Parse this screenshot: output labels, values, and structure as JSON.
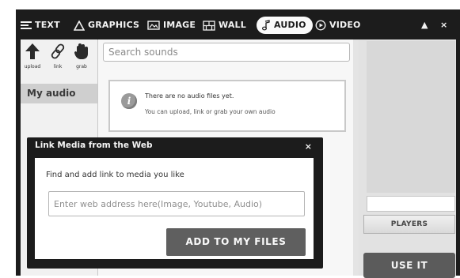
{
  "tabs": [
    {
      "label": "TEXT",
      "icon": "menu-lines-icon"
    },
    {
      "label": "GRAPHICS",
      "icon": "triangle-icon"
    },
    {
      "label": "IMAGE",
      "icon": "image-icon"
    },
    {
      "label": "WALL",
      "icon": "wall-icon"
    },
    {
      "label": "AUDIO",
      "icon": "music-note-icon",
      "active": true
    },
    {
      "label": "VIDEO",
      "icon": "play-circle-icon"
    }
  ],
  "window_controls": {
    "collapse": "▲",
    "close": "×"
  },
  "tools": [
    {
      "label": "upload",
      "icon": "upload-arrow-icon"
    },
    {
      "label": "link",
      "icon": "chain-link-icon"
    },
    {
      "label": "grab",
      "icon": "grab-hand-icon"
    }
  ],
  "sidebar": {
    "my_audio": "My audio"
  },
  "search": {
    "placeholder": "Search sounds"
  },
  "empty_state": {
    "line1": "There are no audio files yet.",
    "line2": "You can upload, link or grab your own audio",
    "icon": "info-icon"
  },
  "right_panel": {
    "players": "PLAYERS",
    "use_it": "USE IT"
  },
  "modal": {
    "title": "Link Media from the Web",
    "close": "×",
    "description": "Find and add link to media you like",
    "input_placeholder": "Enter web address here(Image, Youtube, Audio)",
    "button": "ADD TO MY FILES"
  },
  "colors": {
    "dark": "#1c1c1c",
    "button_gray": "#5f5f5f",
    "panel_gray": "#e2e2e2"
  }
}
